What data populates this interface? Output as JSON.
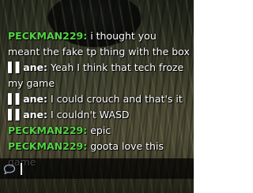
{
  "colors": {
    "player_name_color": "#56d246",
    "masked_name_color": "#ffffff",
    "message_color": "#ffffff"
  },
  "chat": {
    "messages": [
      {
        "sender": "PECKMAN229:",
        "sender_color": "#56d246",
        "text": " i thought you meant the fake tp thing with the box"
      },
      {
        "sender": "▌▌ane:",
        "sender_color": "#ffffff",
        "text": " Yeah I think that tech froze my game"
      },
      {
        "sender": "▌▌ane:",
        "sender_color": "#ffffff",
        "text": " I could crouch and that's it"
      },
      {
        "sender": "▌▌ane:",
        "sender_color": "#ffffff",
        "text": " I couldn't WASD"
      },
      {
        "sender": "PECKMAN229:",
        "sender_color": "#56d246",
        "text": " epic"
      },
      {
        "sender": "PECKMAN229:",
        "sender_color": "#56d246",
        "text": " goota love this game"
      }
    ],
    "input": {
      "value": "",
      "icon": "chat-bubble-icon"
    }
  }
}
